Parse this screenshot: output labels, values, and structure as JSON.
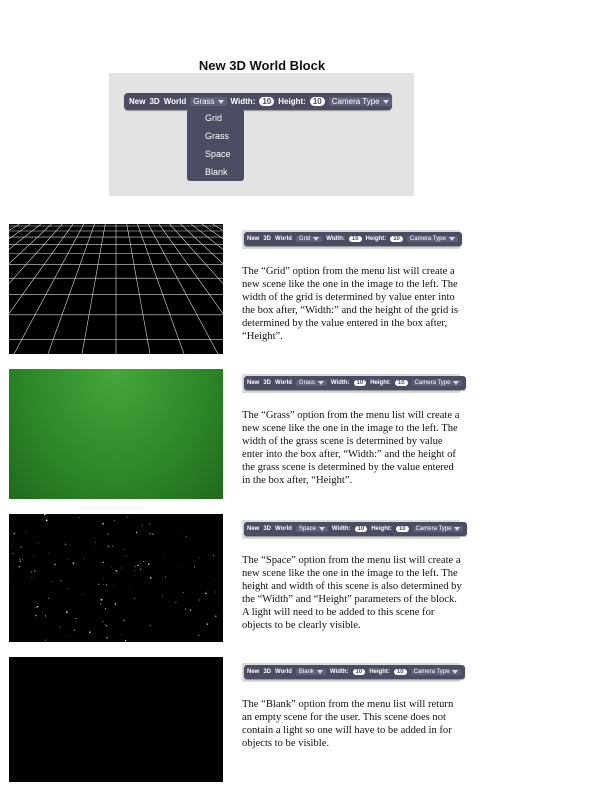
{
  "title": "New 3D World Block",
  "block": {
    "new": "New",
    "three_d": "3D",
    "world": "World",
    "width_label": "Width:",
    "width_value": "10",
    "height_label": "Height:",
    "height_value": "10",
    "camera_type": "Camera Type"
  },
  "hero": {
    "selected": "Grass"
  },
  "menu_items": [
    "Grid",
    "Grass",
    "Space",
    "Blank"
  ],
  "sections": [
    {
      "option": "Grid",
      "text": "The “Grid” option from the menu list will create a new scene like the one in the image to the left. The width of the grid is determined by value enter into the box after, “Width:” and the height of the grid is determined by the value entered in the box after, “Height”."
    },
    {
      "option": "Grass",
      "text": " The “Grass” option from the menu list will create a new scene like the one in the image to the left. The width of the grass scene is determined by value enter into the box after, “Width:” and the height of the grass scene is determined by the value entered in the box after, “Height”."
    },
    {
      "option": "Space",
      "text": "The “Space” option from the menu list will create a new scene like the one in the image to the left. The height and width of this scene is also determined by the “Width” and “Height” parameters of the block. A light will need to be added to this scene for objects to be clearly visible."
    },
    {
      "option": "Blank",
      "text": "The “Blank” option from the menu list will return an empty scene for the user. This scene does not contain a light so one will have to be added in for objects to be visible."
    }
  ],
  "colors": {
    "block": "#4c4c63",
    "grass": "#2f8a2a",
    "grid_line": "#dddddd"
  }
}
